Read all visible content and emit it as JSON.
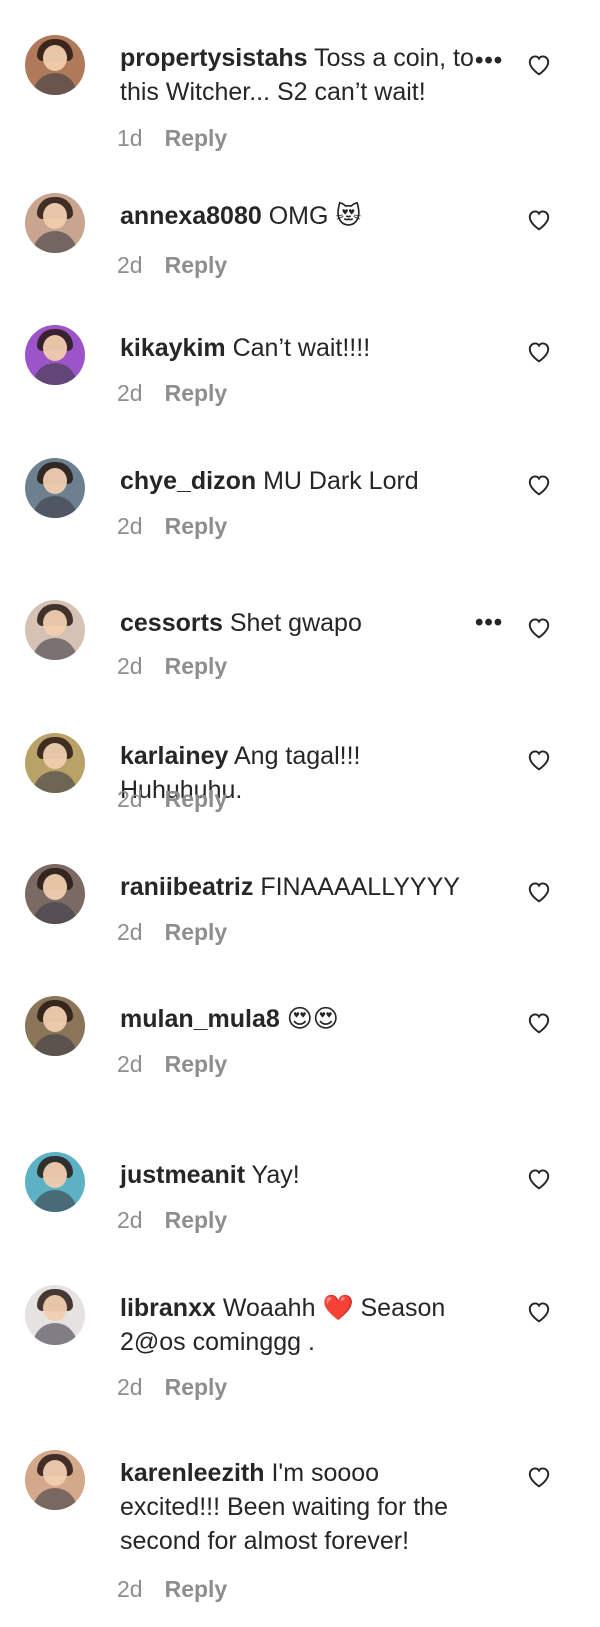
{
  "comments": [
    {
      "username": "propertysistahs",
      "text": "Toss a coin, to this Witcher... S2 can’t wait!",
      "time": "1d",
      "reply": "Reply",
      "has_more": true,
      "avatar_bg": "#b07a5a"
    },
    {
      "username": "annexa8080",
      "text": "OMG",
      "emoji": "😻",
      "time": "2d",
      "reply": "Reply",
      "has_more": false,
      "avatar_bg": "#c9a48f"
    },
    {
      "username": "kikaykim",
      "text": "Can’t wait!!!!",
      "time": "2d",
      "reply": "Reply",
      "has_more": false,
      "avatar_bg": "#9b55c8"
    },
    {
      "username": "chye_dizon",
      "text": "MU Dark Lord",
      "time": "2d",
      "reply": "Reply",
      "has_more": false,
      "avatar_bg": "#6d8090"
    },
    {
      "username": "cessorts",
      "text": "Shet gwapo",
      "time": "2d",
      "reply": "Reply",
      "has_more": true,
      "avatar_bg": "#d6c2b4"
    },
    {
      "username": "karlainey",
      "text": "Ang tagal!!! Huhuhuhu.",
      "time": "2d",
      "reply": "Reply",
      "has_more": false,
      "avatar_bg": "#b9a267"
    },
    {
      "username": "raniibeatriz",
      "text": "FINAAAALLYYYY",
      "time": "2d",
      "reply": "Reply",
      "has_more": false,
      "avatar_bg": "#7b6a64"
    },
    {
      "username": "mulan_mula8",
      "text": "",
      "emoji": "😍😍",
      "time": "2d",
      "reply": "Reply",
      "has_more": false,
      "avatar_bg": "#8a7558"
    },
    {
      "username": "justmeanit",
      "text": "Yay!",
      "time": "2d",
      "reply": "Reply",
      "has_more": false,
      "avatar_bg": "#5cb2c4"
    },
    {
      "username": "libranxx",
      "text": "Woaahh ❤️ Season 2@os cominggg .",
      "time": "2d",
      "reply": "Reply",
      "has_more": false,
      "avatar_bg": "#e6e2e2"
    },
    {
      "username": "karenleezith",
      "text": "I'm soooo excited!!! Been waiting for the second for almost forever!",
      "time": "2d",
      "reply": "Reply",
      "has_more": false,
      "avatar_bg": "#d4a88a"
    }
  ]
}
